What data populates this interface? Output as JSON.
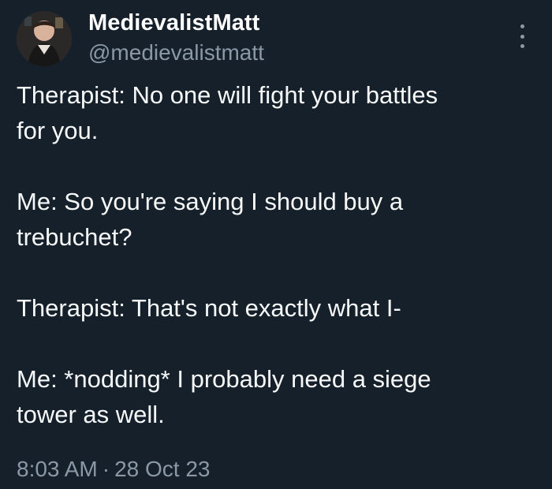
{
  "author": {
    "display_name": "MedievalistMatt",
    "handle": "@medievalistmatt"
  },
  "tweet": {
    "paragraphs": [
      [
        "Therapist: No one will fight your battles",
        "for you."
      ],
      [
        "Me: So you're saying I should buy a",
        "trebuchet?"
      ],
      [
        "Therapist: That's not exactly what I-"
      ],
      [
        "Me: *nodding* I probably need a siege",
        "tower as well."
      ]
    ],
    "time": "8:03 AM",
    "separator": "·",
    "date": "28 Oct 23"
  },
  "icons": {
    "more": "more-options-icon",
    "avatar": "profile-photo"
  },
  "colors": {
    "background": "#15202b",
    "text": "#f7f9f9",
    "muted": "#8b98a5"
  }
}
